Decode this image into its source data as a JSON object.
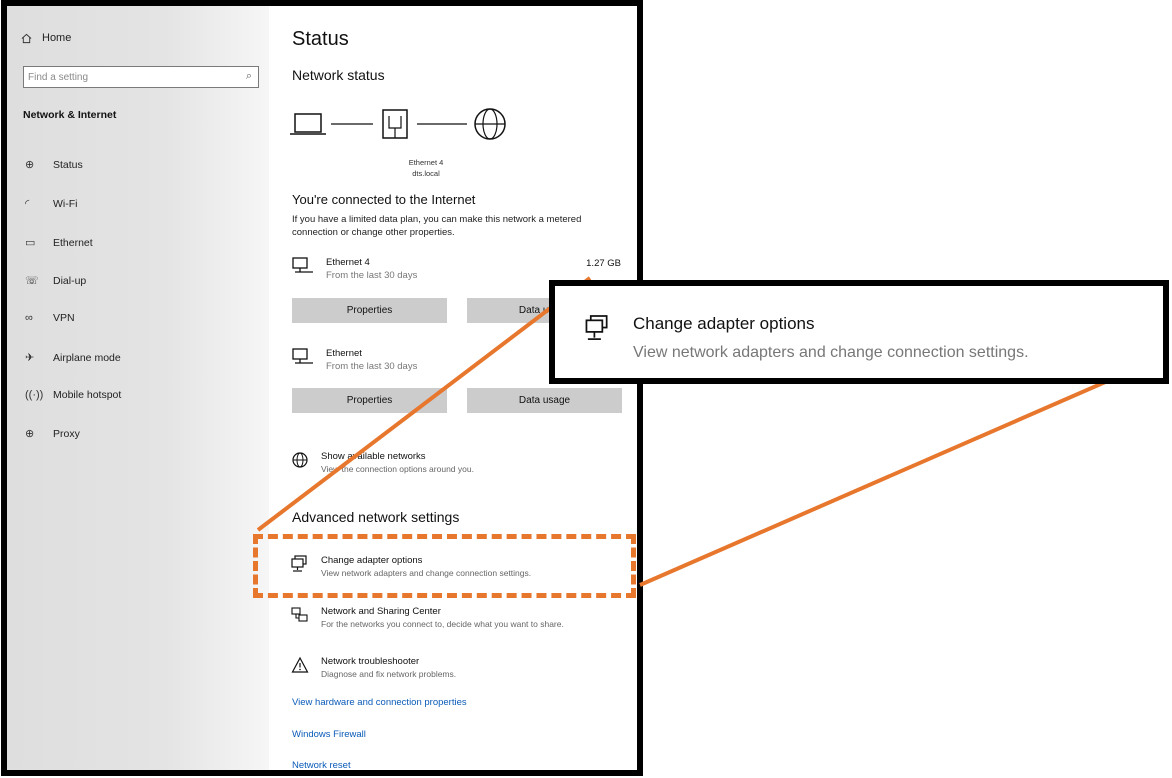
{
  "sidebar": {
    "home_label": "Home",
    "search_placeholder": "Find a setting",
    "heading": "Network & Internet",
    "items": [
      {
        "label": "Status",
        "icon": "status-globe-icon"
      },
      {
        "label": "Wi-Fi",
        "icon": "wifi-icon"
      },
      {
        "label": "Ethernet",
        "icon": "ethernet-icon"
      },
      {
        "label": "Dial-up",
        "icon": "dialup-icon"
      },
      {
        "label": "VPN",
        "icon": "vpn-icon"
      },
      {
        "label": "Airplane mode",
        "icon": "airplane-icon"
      },
      {
        "label": "Mobile hotspot",
        "icon": "hotspot-icon"
      },
      {
        "label": "Proxy",
        "icon": "globe-icon"
      }
    ]
  },
  "main": {
    "title": "Status",
    "network_status_title": "Network status",
    "diagram": {
      "adapter_name": "Ethernet 4",
      "domain": "dts.local"
    },
    "connected_title": "You're connected to the Internet",
    "connected_desc": "If you have a limited data plan, you can make this network a metered connection or change other properties.",
    "adapters": [
      {
        "name": "Ethernet 4",
        "sub": "From the last 30 days",
        "usage": "1.27 GB",
        "properties_label": "Properties",
        "data_usage_label": "Data usage"
      },
      {
        "name": "Ethernet",
        "sub": "From the last 30 days",
        "usage": "",
        "properties_label": "Properties",
        "data_usage_label": "Data usage"
      }
    ],
    "show_networks": {
      "title": "Show available networks",
      "desc": "View the connection options around you."
    },
    "advanced_title": "Advanced network settings",
    "advanced_items": [
      {
        "title": "Change adapter options",
        "desc": "View network adapters and change connection settings.",
        "icon": "adapter-icon"
      },
      {
        "title": "Network and Sharing Center",
        "desc": "For the networks you connect to, decide what you want to share.",
        "icon": "sharing-center-icon"
      },
      {
        "title": "Network troubleshooter",
        "desc": "Diagnose and fix network problems.",
        "icon": "warning-icon"
      }
    ],
    "links": [
      "View hardware and connection properties",
      "Windows Firewall",
      "Network reset"
    ]
  },
  "callout": {
    "title": "Change adapter options",
    "desc": "View network adapters and change connection settings."
  },
  "colors": {
    "accent": "#e8772e",
    "link": "#0a5bb8",
    "button": "#cccccc"
  }
}
